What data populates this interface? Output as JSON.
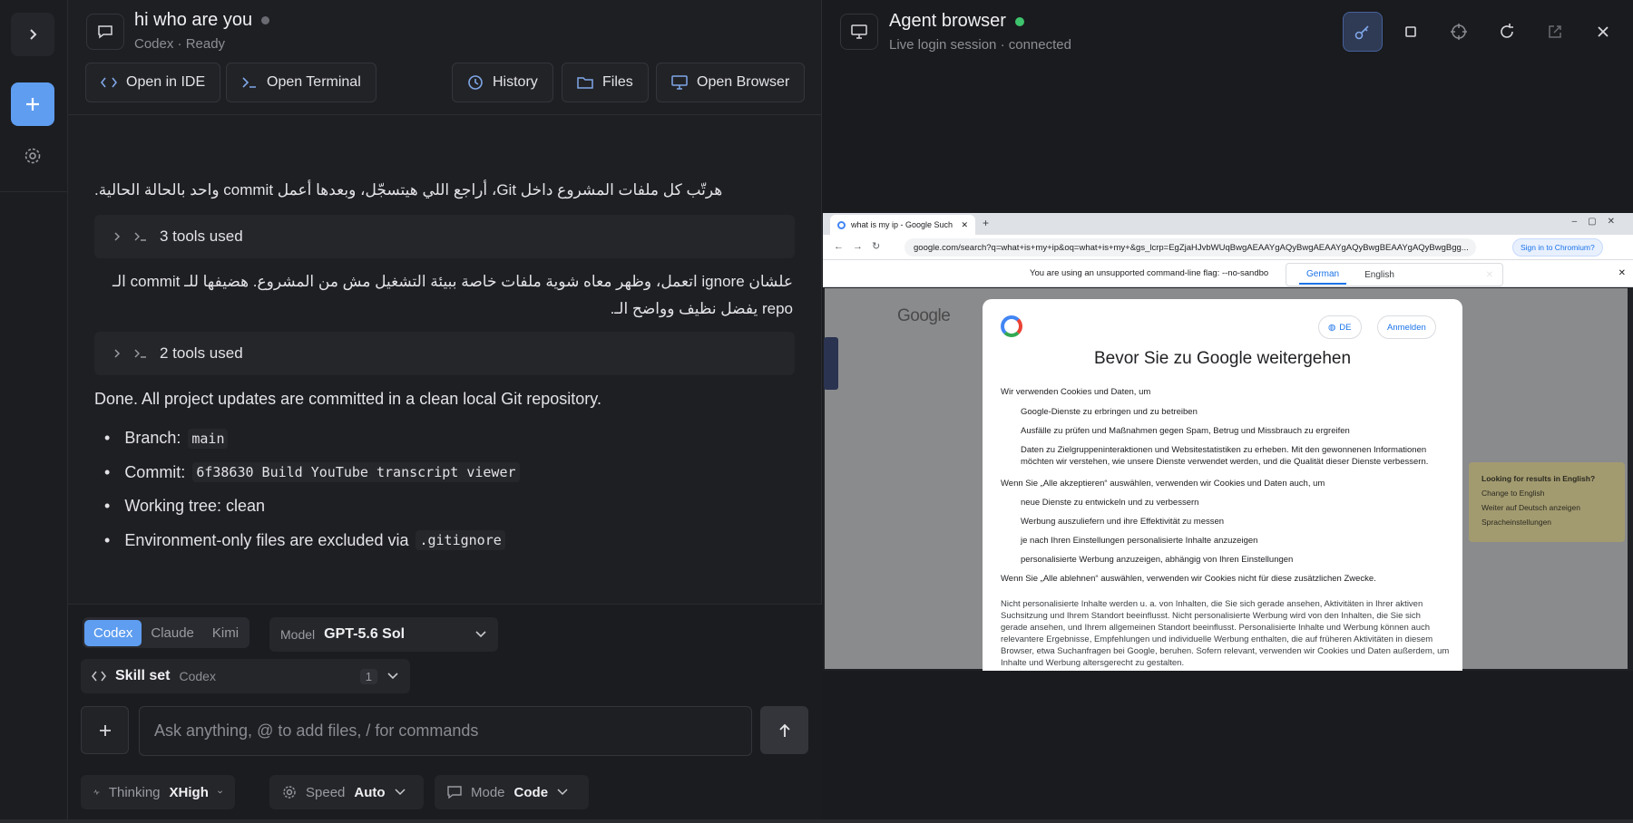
{
  "chat": {
    "title": "hi who are you",
    "subtitle": "Codex · Ready",
    "toolbar": {
      "open_ide": "Open in IDE",
      "open_terminal": "Open Terminal",
      "history": "History",
      "files": "Files",
      "open_browser": "Open Browser"
    },
    "messages": {
      "arabic_1": "هرتّب كل ملفات المشروع داخل Git، أراجع اللي هيتسجّل، وبعدها أعمل commit واحد بالحالة الحالية.",
      "tools_1": "3 tools used",
      "arabic_2": "علشان ignore اتعمل، وظهر معاه شوية ملفات خاصة ببيئة التشغيل مش من المشروع. هضيفها للـ commit الـ repo يفضل نظيف وواضح الـ.",
      "tools_2": "2 tools used",
      "done": "Done. All project updates are committed in a clean local Git repository.",
      "bullets": [
        {
          "label": "Branch:",
          "code": "main"
        },
        {
          "label": "Commit:",
          "code": "6f38630 Build YouTube transcript viewer"
        },
        {
          "label": "Working tree: clean",
          "code": ""
        },
        {
          "label": "Environment-only files are excluded via",
          "code": ".gitignore"
        }
      ]
    },
    "composer": {
      "agents": [
        "Codex",
        "Claude",
        "Kimi"
      ],
      "active_agent": "Codex",
      "model_label": "Model",
      "model_value": "GPT-5.6 Sol",
      "skill_title": "Skill set",
      "skill_sub": "Codex",
      "skill_count": "1",
      "input_placeholder": "Ask anything, @ to add files, / for commands",
      "thinking_label": "Thinking",
      "thinking_value": "XHigh",
      "speed_label": "Speed",
      "speed_value": "Auto",
      "mode_label": "Mode",
      "mode_value": "Code"
    }
  },
  "agent": {
    "title": "Agent browser",
    "subtitle": "Live login session · connected",
    "browser": {
      "tab_title": "what is my ip - Google Such",
      "url": "google.com/search?q=what+is+my+ip&oq=what+is+my+&gs_lcrp=EgZjaHJvbWUqBwgAEAAYgAQyBwgAEAAYgAQyBwgBEAAYgAQyBwgBgg...",
      "signin": "Sign in to Chromium?",
      "infobar": "You are using an unsupported command-line flag: --no-sandbo",
      "translate_german": "German",
      "translate_english": "English",
      "google_logo": "Google",
      "consent": {
        "lang_btn": "DE",
        "signin_btn": "Anmelden",
        "title": "Bevor Sie zu Google weitergehen",
        "intro": "Wir verwenden Cookies und Daten, um",
        "items": [
          "Google-Dienste zu erbringen und zu betreiben",
          "Ausfälle zu prüfen und Maßnahmen gegen Spam, Betrug und Missbrauch zu ergreifen",
          "Daten zu Zielgruppeninteraktionen und Websitestatistiken zu erheben. Mit den gewonnenen Informationen möchten wir verstehen, wie unsere Dienste verwendet werden, und die Qualität dieser Dienste verbessern."
        ],
        "accept_intro": "Wenn Sie „Alle akzeptieren“ auswählen, verwenden wir Cookies und Daten auch, um",
        "accept_items": [
          "neue Dienste zu entwickeln und zu verbessern",
          "Werbung auszuliefern und ihre Effektivität zu messen",
          "je nach Ihren Einstellungen personalisierte Inhalte anzuzeigen",
          "personalisierte Werbung anzuzeigen, abhängig von Ihren Einstellungen"
        ],
        "reject_intro": "Wenn Sie „Alle ablehnen“ auswählen, verwenden wir Cookies nicht für diese zusätzlichen Zwecke.",
        "para": "Nicht personalisierte Inhalte werden u. a. von Inhalten, die Sie sich gerade ansehen, Aktivitäten in Ihrer aktiven Suchsitzung und Ihrem Standort beeinflusst. Nicht personalisierte Werbung wird von den Inhalten, die Sie sich gerade ansehen, und Ihrem allgemeinen Standort beeinflusst. Personalisierte Inhalte und Werbung können auch relevantere Ergebnisse, Empfehlungen und individuelle Werbung enthalten, die auf früheren Aktivitäten in diesem Browser, etwa Suchanfragen bei Google, beruhen. Sofern relevant, verwenden wir Cookies und Daten außerdem, um Inhalte und Werbung altersgerecht zu gestalten."
      },
      "side_card": {
        "title": "Looking for results in English?",
        "link1": "Change to English",
        "link2": "Weiter auf Deutsch anzeigen",
        "link3": "Spracheinstellungen"
      }
    }
  },
  "colors": {
    "accent": "#5e9df0",
    "status_green": "#3ec46d",
    "background": "#1e1f23"
  }
}
